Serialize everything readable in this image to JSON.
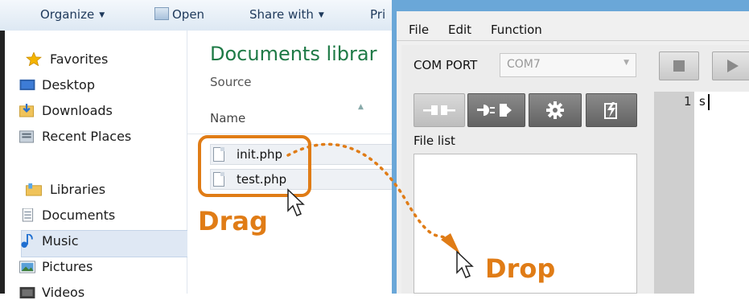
{
  "explorer": {
    "toolbar": {
      "organize": "Organize",
      "open": "Open",
      "share_with": "Share with",
      "print": "Pri"
    },
    "nav": {
      "favorites": "Favorites",
      "desktop": "Desktop",
      "downloads": "Downloads",
      "recent_places": "Recent Places",
      "libraries": "Libraries",
      "documents": "Documents",
      "music": "Music",
      "pictures": "Pictures",
      "videos": "Videos"
    },
    "content": {
      "title": "Documents librar",
      "subtitle": "Source",
      "column_name": "Name",
      "files": [
        "init.php",
        "test.php"
      ]
    }
  },
  "program": {
    "menu": [
      "File",
      "Edit",
      "Function"
    ],
    "com_port_label": "COM PORT",
    "com_port_value": "COM7",
    "file_list_label": "File list",
    "editor": {
      "line_number": "1",
      "text": "s"
    },
    "icons": [
      "disconnect-icon",
      "connect-icon",
      "settings-gear-icon",
      "flash-chip-icon",
      "stop-icon",
      "play-icon"
    ]
  },
  "annotation": {
    "drag": "Drag",
    "drop": "Drop",
    "accent_color": "#e07c16"
  }
}
